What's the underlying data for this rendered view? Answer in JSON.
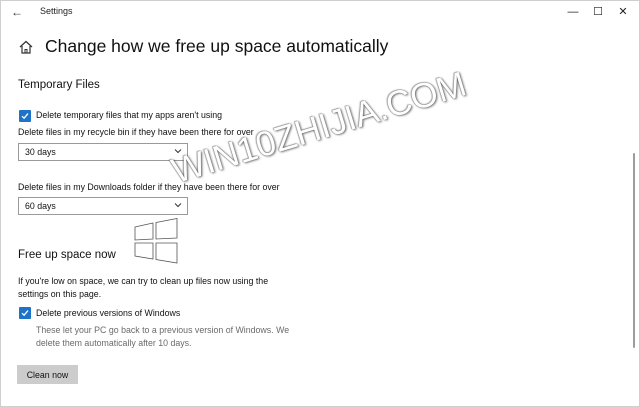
{
  "titlebar": {
    "app_title": "Settings",
    "back_glyph": "←",
    "minimize_glyph": "—",
    "maximize_glyph": "☐",
    "close_glyph": "✕"
  },
  "page": {
    "title": "Change how we free up space automatically"
  },
  "temporary_files": {
    "heading": "Temporary Files",
    "delete_temp_label": "Delete temporary files that my apps aren't using",
    "delete_temp_checked": true,
    "recycle_bin_label": "Delete files in my recycle bin if they have been there for over",
    "recycle_bin_value": "30 days",
    "downloads_label": "Delete files in my Downloads folder if they have been there for over",
    "downloads_value": "60 days"
  },
  "free_up_now": {
    "heading": "Free up space now",
    "description_line1": "If you're low on space, we can try to clean up files now using the",
    "description_line2": "settings on this page.",
    "previous_windows_label": "Delete previous versions of Windows",
    "previous_windows_checked": true,
    "note_line1": "These let your PC go back to a previous version of Windows. We",
    "note_line2": "delete them automatically after 10 days.",
    "clean_button": "Clean now"
  },
  "watermark": {
    "text": "WIN10ZHIJIA.COM"
  },
  "colors": {
    "accent": "#1e73c9",
    "button_bg": "#cccccc",
    "muted_text": "#6a6a6a"
  },
  "icons": {
    "back": "arrow-left-icon",
    "home": "home-icon",
    "check": "checkmark-icon",
    "dropdown": "chevron-down-icon",
    "logo": "windows-logo-icon"
  }
}
